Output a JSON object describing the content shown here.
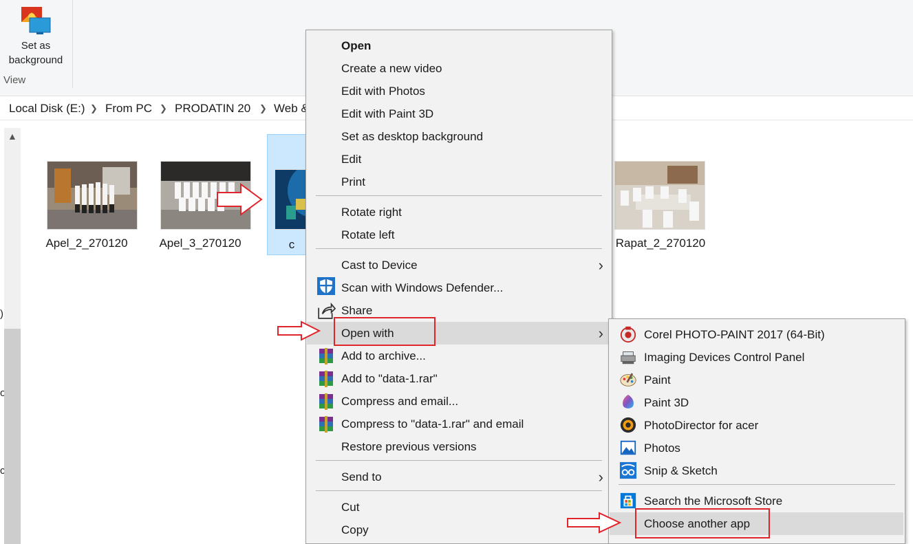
{
  "ribbon": {
    "set_background_label": "Set as background",
    "group_label": "View"
  },
  "address": {
    "crumbs": [
      "Local Disk (E:)",
      "From PC",
      "PRODATIN 20",
      "Web &"
    ]
  },
  "nav": {
    "edge_glyphs": [
      ")",
      "o",
      "c"
    ]
  },
  "files": [
    {
      "name": "Apel_2_270120"
    },
    {
      "name": "Apel_3_270120"
    },
    {
      "name": "c"
    },
    {
      "name": "Rapat_2_270120"
    }
  ],
  "context_menu": {
    "items": [
      {
        "label": "Open",
        "bold": true
      },
      {
        "label": "Create a new video"
      },
      {
        "label": "Edit with Photos"
      },
      {
        "label": "Edit with Paint 3D"
      },
      {
        "label": "Set as desktop background"
      },
      {
        "label": "Edit"
      },
      {
        "label": "Print"
      },
      {
        "label": "Rotate right"
      },
      {
        "label": "Rotate left"
      },
      {
        "label": "Cast to Device",
        "submenu": true
      },
      {
        "label": "Scan with Windows Defender...",
        "icon": "shield-icon"
      },
      {
        "label": "Share",
        "icon": "share-icon"
      },
      {
        "label": "Open with",
        "submenu": true,
        "highlighted": true
      },
      {
        "label": "Add to archive...",
        "icon": "winrar-icon"
      },
      {
        "label": "Add to \"data-1.rar\"",
        "icon": "winrar-icon"
      },
      {
        "label": "Compress and email...",
        "icon": "winrar-icon"
      },
      {
        "label": "Compress to \"data-1.rar\" and email",
        "icon": "winrar-icon"
      },
      {
        "label": "Restore previous versions"
      },
      {
        "label": "Send to",
        "submenu": true
      },
      {
        "label": "Cut"
      },
      {
        "label": "Copy"
      }
    ],
    "submenu_chevron": "›"
  },
  "open_with_menu": {
    "items": [
      {
        "label": "Corel PHOTO-PAINT 2017 (64-Bit)",
        "icon": "corel-icon"
      },
      {
        "label": "Imaging Devices Control Panel",
        "icon": "scanner-icon"
      },
      {
        "label": "Paint",
        "icon": "paint-palette-icon"
      },
      {
        "label": "Paint 3D",
        "icon": "paint3d-icon"
      },
      {
        "label": "PhotoDirector for acer",
        "icon": "photodirector-icon"
      },
      {
        "label": "Photos",
        "icon": "photos-icon"
      },
      {
        "label": "Snip & Sketch",
        "icon": "snip-sketch-icon"
      },
      {
        "label": "Search the Microsoft Store",
        "icon": "store-icon"
      },
      {
        "label": "Choose another app",
        "highlighted": true
      }
    ]
  },
  "colors": {
    "annotation_red": "#e0242c",
    "selection_blue": "#cce8ff",
    "menu_bg": "#f2f2f2",
    "menu_highlight": "#dadada"
  }
}
